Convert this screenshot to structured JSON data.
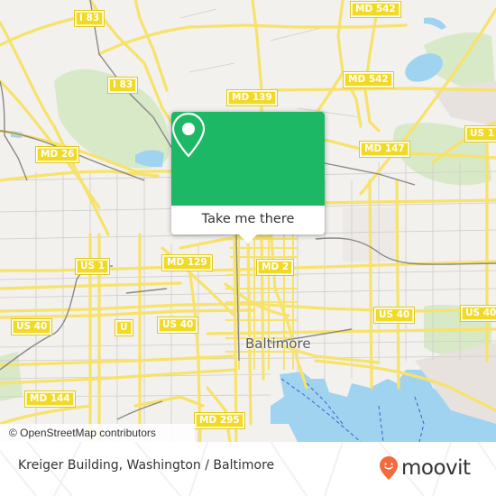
{
  "map": {
    "city_label": "Baltimore",
    "attribution": "© OpenStreetMap contributors",
    "road_shields": [
      {
        "label": "I 83"
      },
      {
        "label": "I 83"
      },
      {
        "label": "MD 542"
      },
      {
        "label": "MD 542"
      },
      {
        "label": "MD 139"
      },
      {
        "label": "MD 26"
      },
      {
        "label": "MD 147"
      },
      {
        "label": "US 1"
      },
      {
        "label": "US 1"
      },
      {
        "label": "MD 129"
      },
      {
        "label": "MD 2"
      },
      {
        "label": "US 40"
      },
      {
        "label": "U"
      },
      {
        "label": "US 40"
      },
      {
        "label": "US 40"
      },
      {
        "label": "US 40"
      },
      {
        "label": "MD 144"
      },
      {
        "label": "MD 295"
      }
    ],
    "colors": {
      "land": "#f2f1ee",
      "road": "#f7e26b",
      "park": "#d4e8c1",
      "water": "#9fd3ef",
      "rail": "#777777",
      "shield": "#f2d926"
    }
  },
  "popup": {
    "cta_label": "Take me there",
    "icon": "map-pin-icon",
    "color": "#1db866"
  },
  "footer": {
    "place_name": "Kreiger Building, Washington / Baltimore",
    "brand": "moovit",
    "brand_color": "#f26a3d"
  }
}
